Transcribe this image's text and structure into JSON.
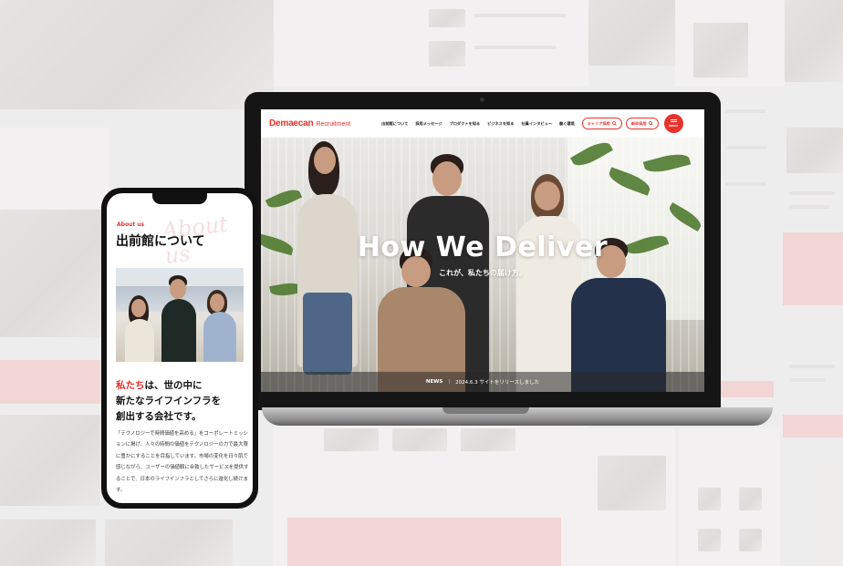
{
  "laptop_site": {
    "logo_brand": "Demaecan",
    "logo_sub": "Recruitment",
    "nav": [
      "出前館について",
      "採用メッセージ",
      "プロダクトを知る",
      "ビジネスを知る",
      "社員インタビュー",
      "働く環境"
    ],
    "career_button": "キャリア採用",
    "newgrad_button": "新卒採用",
    "menu_label": "MENU",
    "hero_title": "How We Deliver",
    "hero_subtitle": "これが、私たちの届け方。",
    "news_label": "NEWS",
    "news_separator": "|",
    "news_text": "2024.6.3 サイトをリリースしました"
  },
  "phone_site": {
    "about_en": "About us",
    "about_script": "About us",
    "about_title": "出前館について",
    "heading_red": "私たち",
    "heading_rest_1": "は、世の中に",
    "heading_line_2": "新たなライフインフラを",
    "heading_line_3": "創出する会社です。",
    "body": "「テクノロジーで時間価値を高める」をコーポレートミッションに掲げ、人々の時間の価値をテクノロジーの力で最大限に豊かにすることを目指しています。市場の変化を日々肌で感じながら、ユーザーの価値観に合致したサービスを提供することで、日本のライフインフラとしてさらに進化し続けます。"
  },
  "colors": {
    "brand_red": "#e8322c",
    "background": "#ecebea"
  },
  "icons": [
    "search-icon",
    "menu-icon"
  ]
}
